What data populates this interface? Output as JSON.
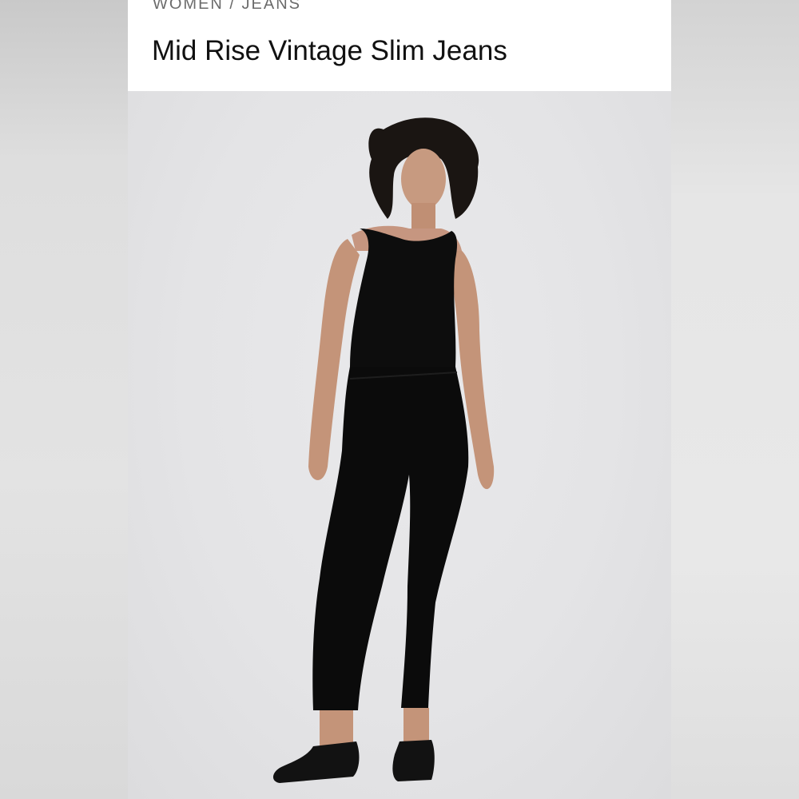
{
  "product": {
    "breadcrumb": "WOMEN / JEANS",
    "title": "Mid Rise Vintage Slim Jeans"
  },
  "colors": {
    "header_background": "#ffffff",
    "photo_background": "#e5e5e7",
    "garment": "#0c0c0c",
    "title_text": "#111111",
    "breadcrumb_text": "#6b6b6b"
  }
}
